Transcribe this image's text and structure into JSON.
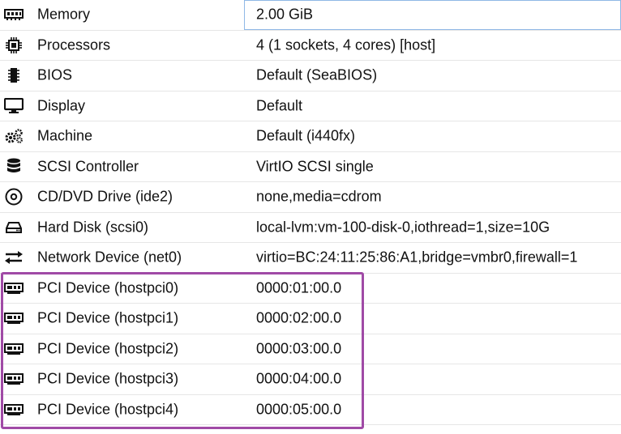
{
  "hardware": {
    "rows": [
      {
        "label": "Memory",
        "value": "2.00 GiB",
        "icon": "memory-icon"
      },
      {
        "label": "Processors",
        "value": "4 (1 sockets, 4 cores) [host]",
        "icon": "cpu-icon"
      },
      {
        "label": "BIOS",
        "value": "Default (SeaBIOS)",
        "icon": "chip-icon"
      },
      {
        "label": "Display",
        "value": "Default",
        "icon": "monitor-icon"
      },
      {
        "label": "Machine",
        "value": "Default (i440fx)",
        "icon": "cogs-icon"
      },
      {
        "label": "SCSI Controller",
        "value": "VirtIO SCSI single",
        "icon": "database-icon"
      },
      {
        "label": "CD/DVD Drive (ide2)",
        "value": "none,media=cdrom",
        "icon": "cdrom-icon"
      },
      {
        "label": "Hard Disk (scsi0)",
        "value": "local-lvm:vm-100-disk-0,iothread=1,size=10G",
        "icon": "hdd-icon"
      },
      {
        "label": "Network Device (net0)",
        "value": "virtio=BC:24:11:25:86:A1,bridge=vmbr0,firewall=1",
        "icon": "exchange-icon"
      },
      {
        "label": "PCI Device (hostpci0)",
        "value": "0000:01:00.0",
        "icon": "pci-card-icon"
      },
      {
        "label": "PCI Device (hostpci1)",
        "value": "0000:02:00.0",
        "icon": "pci-card-icon"
      },
      {
        "label": "PCI Device (hostpci2)",
        "value": "0000:03:00.0",
        "icon": "pci-card-icon"
      },
      {
        "label": "PCI Device (hostpci3)",
        "value": "0000:04:00.0",
        "icon": "pci-card-icon"
      },
      {
        "label": "PCI Device (hostpci4)",
        "value": "0000:05:00.0",
        "icon": "pci-card-icon"
      }
    ],
    "selected_row": 0
  },
  "colors": {
    "highlight": "#a04aa6",
    "selection_border": "#8fb8e6",
    "text": "#111111"
  }
}
